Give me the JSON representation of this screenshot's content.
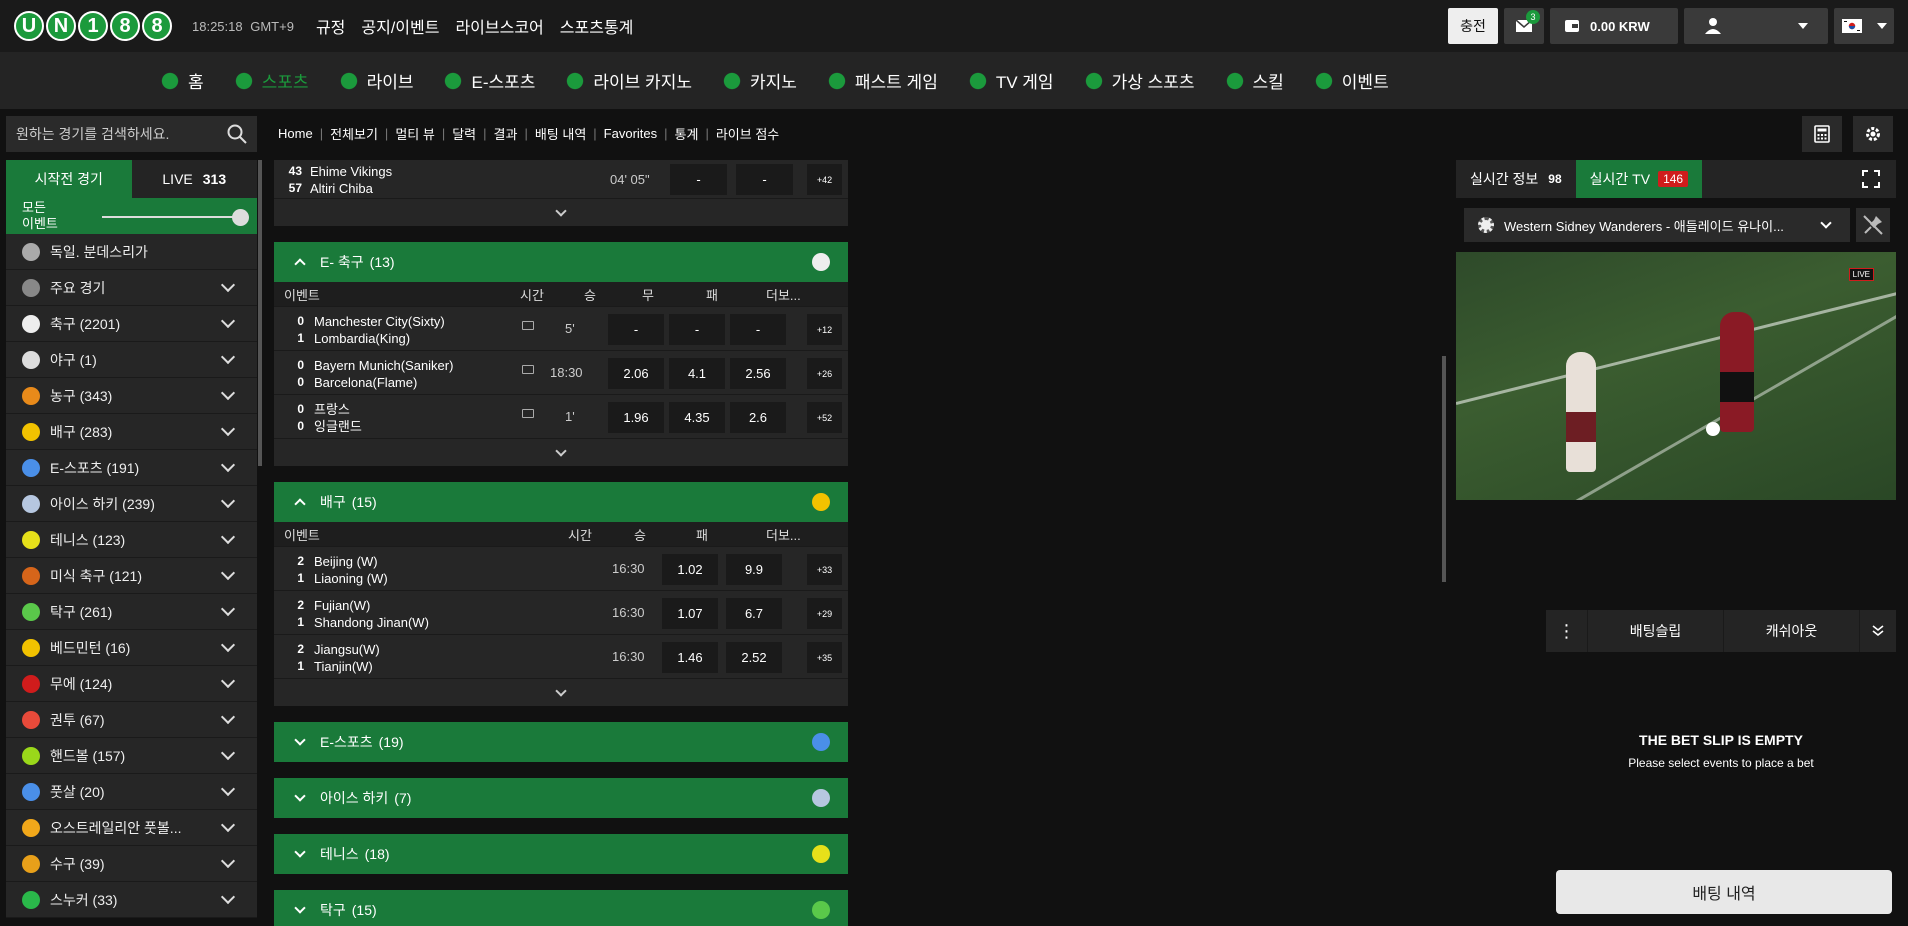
{
  "header": {
    "logo": [
      "U",
      "N",
      "1",
      "8",
      "8"
    ],
    "clock": "18:25:18",
    "timezone": "GMT+9",
    "nav": [
      "규정",
      "공지/이벤트",
      "라이브스코어",
      "스포츠통계"
    ],
    "charge_label": "충전",
    "mail_count": "3",
    "balance": "0.00 KRW"
  },
  "mainnav": [
    {
      "label": "홈",
      "icon": "home-icon",
      "color": "#1b9a3c"
    },
    {
      "label": "스포츠",
      "icon": "soccer-ball-icon",
      "color": "#1b9a3c",
      "active": true
    },
    {
      "label": "라이브",
      "icon": "live-icon",
      "color": "#1b9a3c"
    },
    {
      "label": "E-스포츠",
      "icon": "gamepad-icon",
      "color": "#1b9a3c"
    },
    {
      "label": "라이브 카지노",
      "icon": "dealer-icon",
      "color": "#1b9a3c"
    },
    {
      "label": "카지노",
      "icon": "casino-icon",
      "color": "#1b9a3c"
    },
    {
      "label": "패스트 게임",
      "icon": "fast-game-icon",
      "color": "#1b9a3c"
    },
    {
      "label": "TV 게임",
      "icon": "tv-icon",
      "color": "#1b9a3c"
    },
    {
      "label": "가상 스포츠",
      "icon": "virtual-sports-icon",
      "color": "#1b9a3c"
    },
    {
      "label": "스킬",
      "icon": "skill-icon",
      "color": "#1b9a3c"
    },
    {
      "label": "이벤트",
      "icon": "gift-icon",
      "color": "#1b9a3c"
    }
  ],
  "sidebar": {
    "search_placeholder": "원하는 경기를 검색하세요.",
    "tab_prematch": "시작전 경기",
    "tab_live": "LIVE",
    "live_count": "313",
    "all_events_line1": "모든",
    "all_events_line2": "이벤트",
    "sports": [
      {
        "label": "독일. 분데스리가",
        "color": "#aaa",
        "chev": false
      },
      {
        "label": "주요 경기",
        "color": "#888",
        "chev": true
      },
      {
        "label": "축구 (2201)",
        "color": "#eee",
        "chev": true
      },
      {
        "label": "야구 (1)",
        "color": "#ddd",
        "chev": true
      },
      {
        "label": "농구 (343)",
        "color": "#e88a1a",
        "chev": true
      },
      {
        "label": "배구 (283)",
        "color": "#f2c200",
        "chev": true
      },
      {
        "label": "E-스포츠 (191)",
        "color": "#4a8fe8",
        "chev": true
      },
      {
        "label": "아이스 하키 (239)",
        "color": "#b6c7e0",
        "chev": true
      },
      {
        "label": "테니스 (123)",
        "color": "#e6e01a",
        "chev": true
      },
      {
        "label": "미식 축구 (121)",
        "color": "#d6651a",
        "chev": true
      },
      {
        "label": "탁구 (261)",
        "color": "#5ac84a",
        "chev": true
      },
      {
        "label": "베드민턴 (16)",
        "color": "#f2c200",
        "chev": true
      },
      {
        "label": "무에 (124)",
        "color": "#d01c1c",
        "chev": true
      },
      {
        "label": "권투 (67)",
        "color": "#e84a3a",
        "chev": true
      },
      {
        "label": "핸드볼 (157)",
        "color": "#9ad81a",
        "chev": true
      },
      {
        "label": "풋살 (20)",
        "color": "#4a8fe8",
        "chev": true
      },
      {
        "label": "오스트레일리안 풋볼...",
        "color": "#f2a81a",
        "chev": true
      },
      {
        "label": "수구 (39)",
        "color": "#e8a01a",
        "chev": true
      },
      {
        "label": "스누커 (33)",
        "color": "#2ab84a",
        "chev": true
      }
    ]
  },
  "breadcrumb": [
    "Home",
    "전체보기",
    "멀티 뷰",
    "달력",
    "결과",
    "배팅 내역",
    "Favorites",
    "통계",
    "라이브 점수"
  ],
  "top_match": {
    "s1": "43",
    "t1": "Ehime Vikings",
    "s2": "57",
    "t2": "Altiri Chiba",
    "time": "04' 05\"",
    "o1": "-",
    "o2": "-",
    "more": "+42"
  },
  "sections": [
    {
      "title": "E- 축구",
      "count": "(13)",
      "open": true,
      "icon_color": "#eee",
      "three_way": true,
      "cols": {
        "event": "이벤트",
        "time": "시간",
        "w": "승",
        "d": "무",
        "l": "패",
        "more": "더보..."
      },
      "matches": [
        {
          "s1": "0",
          "t1": "Manchester City(Sixty)",
          "s2": "1",
          "t2": "Lombardia(King)",
          "time": "5'",
          "o": [
            "-",
            "-",
            "-"
          ],
          "more": "+12",
          "tv": true
        },
        {
          "s1": "0",
          "t1": "Bayern Munich(Saniker)",
          "s2": "0",
          "t2": "Barcelona(Flame)",
          "time": "18:30",
          "o": [
            "2.06",
            "4.1",
            "2.56"
          ],
          "more": "+26",
          "tv": true
        },
        {
          "s1": "0",
          "t1": "프랑스",
          "s2": "0",
          "t2": "잉글랜드",
          "time": "1'",
          "o": [
            "1.96",
            "4.35",
            "2.6"
          ],
          "more": "+52",
          "tv": true
        }
      ]
    },
    {
      "title": "배구",
      "count": "(15)",
      "open": true,
      "icon_color": "#f2c200",
      "three_way": false,
      "cols": {
        "event": "이벤트",
        "time": "시간",
        "w": "승",
        "l": "패",
        "more": "더보..."
      },
      "matches": [
        {
          "s1": "2",
          "t1": "Beijing (W)",
          "s2": "1",
          "t2": "Liaoning (W)",
          "time": "16:30",
          "o": [
            "1.02",
            "9.9"
          ],
          "more": "+33"
        },
        {
          "s1": "2",
          "t1": "Fujian(W)",
          "s2": "1",
          "t2": "Shandong Jinan(W)",
          "time": "16:30",
          "o": [
            "1.07",
            "6.7"
          ],
          "more": "+29"
        },
        {
          "s1": "2",
          "t1": "Jiangsu(W)",
          "s2": "1",
          "t2": "Tianjin(W)",
          "time": "16:30",
          "o": [
            "1.46",
            "2.52"
          ],
          "more": "+35"
        }
      ]
    },
    {
      "title": "E-스포츠",
      "count": "(19)",
      "open": false,
      "icon_color": "#4a8fe8"
    },
    {
      "title": "아이스 하키",
      "count": "(7)",
      "open": false,
      "icon_color": "#b6c7e0"
    },
    {
      "title": "테니스",
      "count": "(18)",
      "open": false,
      "icon_color": "#e6e01a"
    },
    {
      "title": "탁구",
      "count": "(15)",
      "open": false,
      "icon_color": "#5ac84a"
    }
  ],
  "right": {
    "tab_info": "실시간 정보",
    "info_count": "98",
    "tab_tv": "실시간 TV",
    "tv_count": "146",
    "match_select": "Western Sidney Wanderers - 애들레이드 유나이...",
    "live_badge": "LIVE"
  },
  "betslip": {
    "tab_slip": "배팅슬립",
    "tab_cashout": "캐쉬아웃",
    "empty_title": "THE BET SLIP IS EMPTY",
    "empty_sub": "Please select events to place a bet",
    "history_btn": "배팅 내역"
  }
}
